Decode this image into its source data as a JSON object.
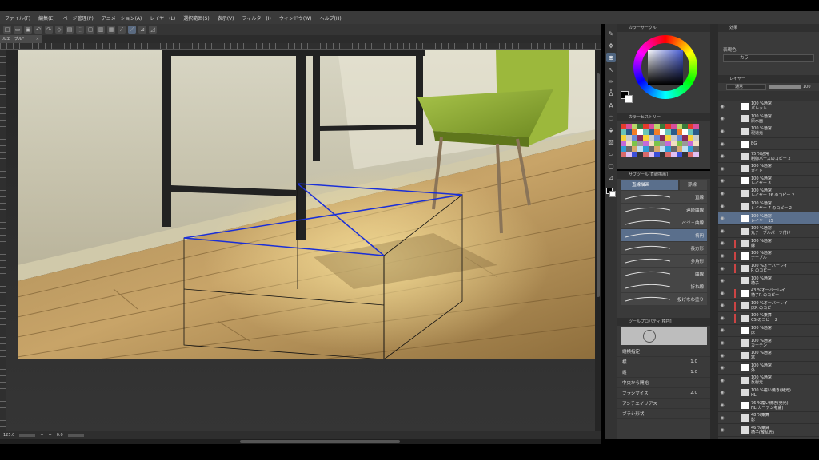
{
  "menu": [
    "ファイル(F)",
    "編集(E)",
    "ページ管理(P)",
    "アニメーション(A)",
    "レイヤー(L)",
    "選択範囲(S)",
    "表示(V)",
    "フィルター(I)",
    "ウィンドウ(W)",
    "ヘルプ(H)"
  ],
  "document_tab": "ルエーブル*",
  "status": {
    "zoom": "125.0",
    "angle": "0.0"
  },
  "panels": {
    "color_circle": "カラーサークル",
    "color_history": "カラーヒストリー",
    "subtool": "サブツール[直線描画]",
    "subtool_tabs": [
      "直線描画",
      "罫線"
    ],
    "tool_property": "ツールプロパティ[楕円]",
    "effect": "効果",
    "display_color_label": "表現色",
    "display_color_value": "カラー",
    "layer": "レイヤー",
    "blend_mode": "通常",
    "opacity": "100"
  },
  "subtools": [
    {
      "label": "直線",
      "active": false
    },
    {
      "label": "連続曲線",
      "active": false
    },
    {
      "label": "ベジェ曲線",
      "active": false
    },
    {
      "label": "楕円",
      "active": true
    },
    {
      "label": "長方形",
      "active": false
    },
    {
      "label": "多角形",
      "active": false
    },
    {
      "label": "曲線",
      "active": false
    },
    {
      "label": "折れ線",
      "active": false
    },
    {
      "label": "投げなわ塗り",
      "active": false
    }
  ],
  "tool_props": [
    {
      "label": "縦横指定",
      "value": ""
    },
    {
      "label": "横",
      "value": "1.0"
    },
    {
      "label": "縦",
      "value": "1.0"
    },
    {
      "label": "中央から開始",
      "value": ""
    },
    {
      "label": "ブラシサイズ",
      "value": "2.0"
    },
    {
      "label": "アンチエイリアス",
      "value": ""
    },
    {
      "label": "ブラシ形状",
      "value": ""
    }
  ],
  "layers": [
    {
      "name": "100 %通常\nパレット",
      "selected": false,
      "red": false
    },
    {
      "name": "100 %通常\n原水面",
      "selected": false,
      "red": false
    },
    {
      "name": "100 %通常\n現道光",
      "selected": false,
      "red": false
    },
    {
      "name": "BG",
      "selected": false,
      "red": false
    },
    {
      "name": "75 %通常\n制御パースのコピー 2",
      "selected": false,
      "red": false
    },
    {
      "name": "100 %通常\nガイド",
      "selected": false,
      "red": false
    },
    {
      "name": "100 %通常\nレイヤー 8",
      "selected": false,
      "red": false
    },
    {
      "name": "100 %通常\nレイヤー 26 のコピー 2",
      "selected": false,
      "red": false
    },
    {
      "name": "100 %通常\nレイヤー 7 のコピー 2",
      "selected": false,
      "red": false
    },
    {
      "name": "100 %通常\nレイヤー 15",
      "selected": true,
      "red": false
    },
    {
      "name": "100 %通常\n丸テーブルパーツ付け",
      "selected": false,
      "red": false
    },
    {
      "name": "100 %通常\n縁",
      "selected": false,
      "red": true
    },
    {
      "name": "100 %通常\nテーブル",
      "selected": false,
      "red": true
    },
    {
      "name": "100 %オーバーレイ\nR のコピー",
      "selected": false,
      "red": true
    },
    {
      "name": "100 %通常\n椅子",
      "selected": false,
      "red": false
    },
    {
      "name": "43 %オーバーレイ\n椅子R のコピー",
      "selected": false,
      "red": true
    },
    {
      "name": "100 %オーバーレイ\n床R のコピー",
      "selected": false,
      "red": true
    },
    {
      "name": "100 %乗算\nCS のコピー 2",
      "selected": false,
      "red": true
    },
    {
      "name": "100 %通常\n床",
      "selected": false,
      "red": false
    },
    {
      "name": "100 %通常\nカーテン",
      "selected": false,
      "red": false
    },
    {
      "name": "100 %通常\n窓",
      "selected": false,
      "red": false
    },
    {
      "name": "100 %通常\n外",
      "selected": false,
      "red": false
    },
    {
      "name": "100 %通常\n反射光",
      "selected": false,
      "red": false
    },
    {
      "name": "100 %覆い焼き(発光)\nHL",
      "selected": false,
      "red": false
    },
    {
      "name": "76 %覆い焼き(発光)\nHL(カーテン考慮)",
      "selected": false,
      "red": false
    },
    {
      "name": "48 %乗算\n影",
      "selected": false,
      "red": false
    },
    {
      "name": "46 %乗算\n椅子(散乱光)",
      "selected": false,
      "red": false
    }
  ],
  "colors": {
    "accent": "#5a6f8c",
    "guide_blue": "#1a2fd8",
    "panel": "#3a3a3a"
  }
}
